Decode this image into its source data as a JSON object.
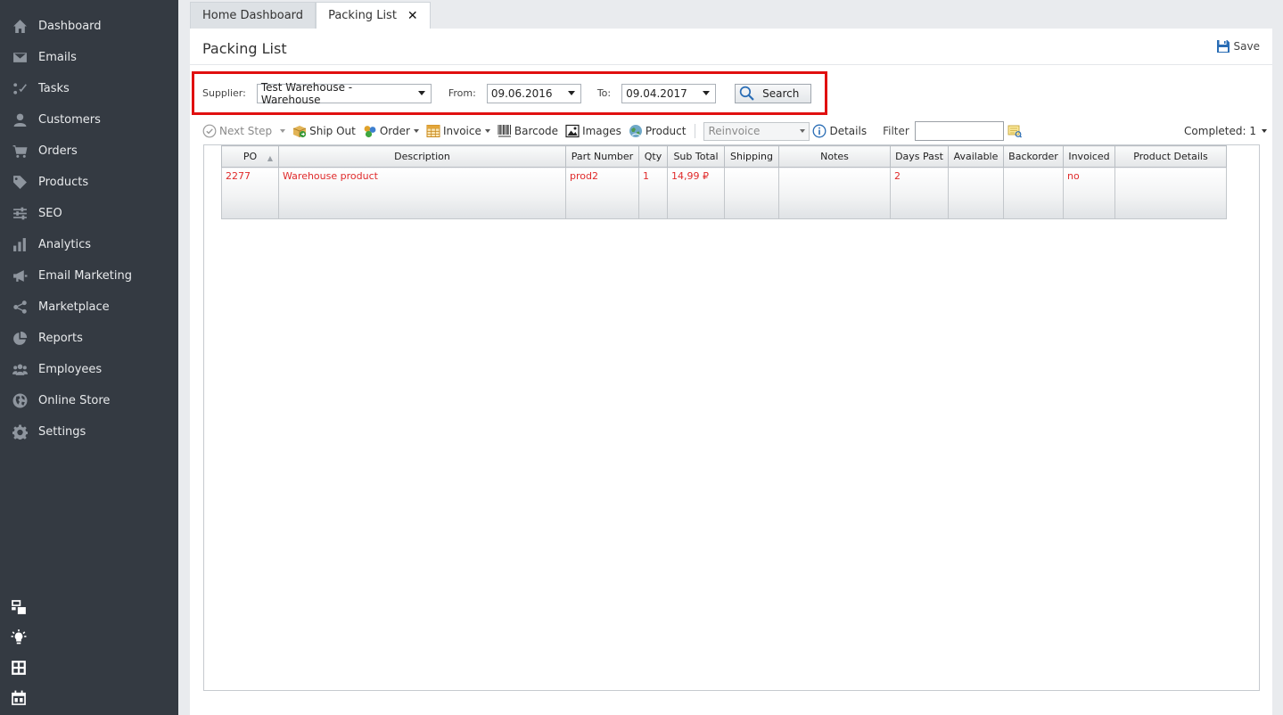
{
  "sidebar": {
    "items": [
      {
        "label": "Dashboard",
        "icon": "home-icon"
      },
      {
        "label": "Emails",
        "icon": "envelope-icon"
      },
      {
        "label": "Tasks",
        "icon": "tasks-icon"
      },
      {
        "label": "Customers",
        "icon": "user-icon"
      },
      {
        "label": "Orders",
        "icon": "cart-icon"
      },
      {
        "label": "Products",
        "icon": "tag-icon"
      },
      {
        "label": "SEO",
        "icon": "sliders-icon"
      },
      {
        "label": "Analytics",
        "icon": "bar-chart-icon"
      },
      {
        "label": "Email Marketing",
        "icon": "megaphone-icon"
      },
      {
        "label": "Marketplace",
        "icon": "share-icon"
      },
      {
        "label": "Reports",
        "icon": "pie-chart-icon"
      },
      {
        "label": "Employees",
        "icon": "users-icon"
      },
      {
        "label": "Online Store",
        "icon": "globe-icon"
      },
      {
        "label": "Settings",
        "icon": "gear-icon"
      }
    ],
    "bottom_icons": [
      "windows-icon",
      "lightbulb-icon",
      "calculator-icon",
      "calendar-icon"
    ]
  },
  "tabs": [
    {
      "label": "Home Dashboard",
      "active": false
    },
    {
      "label": "Packing List",
      "active": true,
      "closable": true
    }
  ],
  "page": {
    "title": "Packing List",
    "save_label": "Save"
  },
  "filter": {
    "supplier_label": "Supplier:",
    "supplier_value": "Test Warehouse - Warehouse",
    "from_label": "From:",
    "from_value": "09.06.2016",
    "to_label": "To:",
    "to_value": "09.04.2017",
    "search_label": "Search"
  },
  "toolbar": {
    "next_step": "Next Step",
    "ship_out": "Ship Out",
    "order": "Order",
    "invoice": "Invoice",
    "barcode": "Barcode",
    "images": "Images",
    "product": "Product",
    "reinvoice": "Reinvoice",
    "details": "Details",
    "filter_label": "Filter",
    "filter_value": "",
    "completed": "Completed: 1"
  },
  "grid": {
    "columns": [
      "PO",
      "Description",
      "Part Number",
      "Qty",
      "Sub Total",
      "Shipping",
      "Notes",
      "Days Past",
      "Available",
      "Backorder",
      "Invoiced",
      "Product Details"
    ],
    "sort_indicator": "▲",
    "rows": [
      [
        "2277",
        "Warehouse product",
        "prod2",
        "1",
        "14,99 ₽",
        "",
        "",
        "2",
        "",
        "",
        "no",
        ""
      ]
    ]
  },
  "colors": {
    "sidebar_bg": "#343a42",
    "highlight_border": "#e01010",
    "row_text": "#e02b2b"
  }
}
